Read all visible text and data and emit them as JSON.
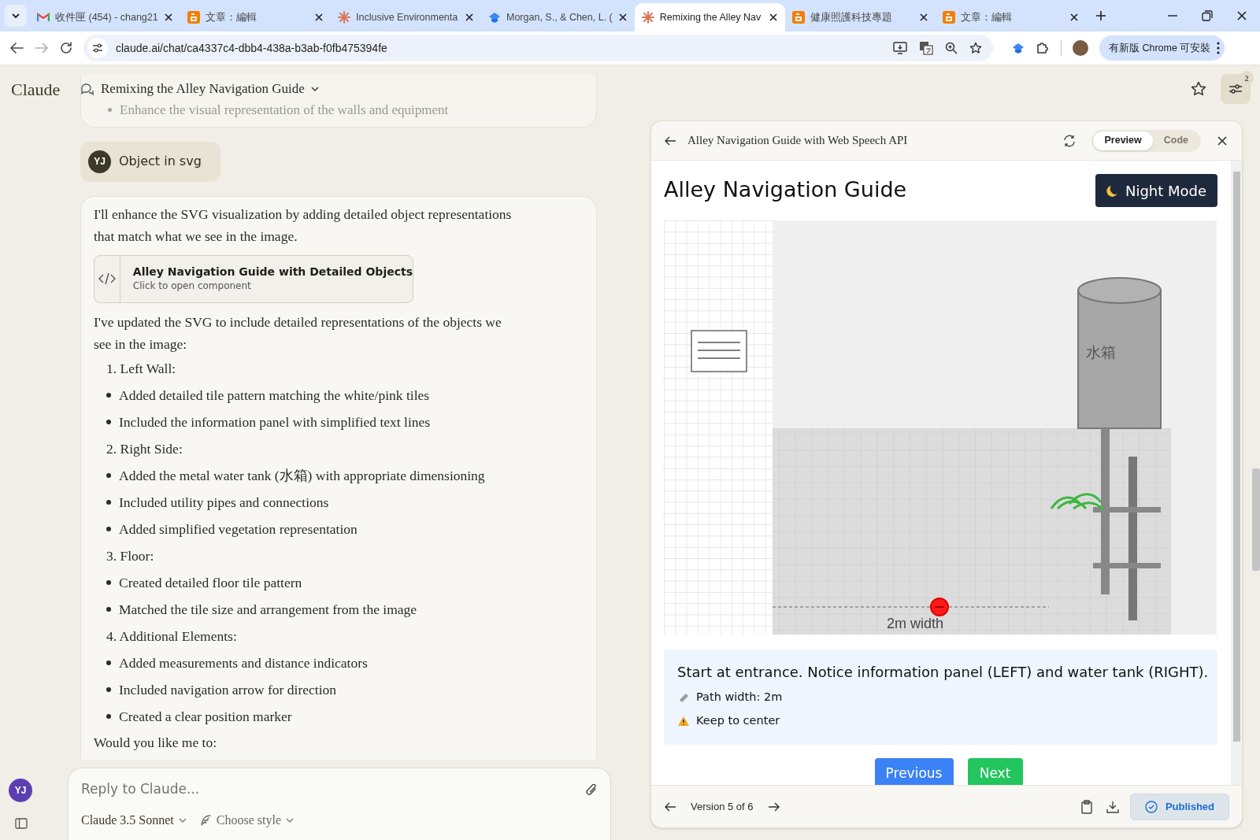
{
  "browser": {
    "tabs": [
      {
        "kind": "mail",
        "label": "收件匣 (454) - chang21",
        "selected": false
      },
      {
        "kind": "blog",
        "label": "文章：編輯",
        "selected": false
      },
      {
        "kind": "spark",
        "label": "Inclusive Environmenta",
        "selected": false
      },
      {
        "kind": "cap",
        "label": "Morgan, S., & Chen, L. (",
        "selected": false
      },
      {
        "kind": "spark",
        "label": "Remixing the Alley Nav",
        "selected": true
      },
      {
        "kind": "blog",
        "label": "健康照護科技專題",
        "selected": false
      },
      {
        "kind": "blog",
        "label": "文章：編輯",
        "selected": false
      }
    ],
    "url": "claude.ai/chat/ca4337c4-dbb4-438a-b3ab-f0fb475394fe",
    "update_button": "有新版 Chrome 可安裝"
  },
  "app": {
    "logo": "Claude",
    "chat_title": "Remixing the Alley Navigation Guide",
    "notification_count": "2"
  },
  "chat": {
    "previous_bullet": "Enhance the visual representation of the walls and equipment",
    "user_message": {
      "avatar": "YJ",
      "text": "Object in svg"
    },
    "reply": {
      "intro": "I'll enhance the SVG visualization by adding detailed object representations that match what we see in the image.",
      "artifact": {
        "title": "Alley Navigation Guide with Detailed Objects",
        "subtitle": "Click to open component"
      },
      "summary": "I've updated the SVG to include detailed representations of the objects we see in the image:",
      "items": [
        {
          "kind": "numbered",
          "number": "1.",
          "text": "Left Wall:"
        },
        {
          "kind": "bullet",
          "text": "Added detailed tile pattern matching the white/pink tiles"
        },
        {
          "kind": "bullet",
          "text": "Included the information panel with simplified text lines"
        },
        {
          "kind": "numbered",
          "number": "2.",
          "text": "Right Side:"
        },
        {
          "kind": "bullet",
          "text": "Added the metal water tank (水箱) with appropriate dimensioning"
        },
        {
          "kind": "bullet",
          "text": "Included utility pipes and connections"
        },
        {
          "kind": "bullet",
          "text": "Added simplified vegetation representation"
        },
        {
          "kind": "numbered",
          "number": "3.",
          "text": "Floor:"
        },
        {
          "kind": "bullet",
          "text": "Created detailed floor tile pattern"
        },
        {
          "kind": "bullet",
          "text": "Matched the tile size and arrangement from the image"
        },
        {
          "kind": "numbered",
          "number": "4.",
          "text": "Additional Elements:"
        },
        {
          "kind": "bullet",
          "text": "Added measurements and distance indicators"
        },
        {
          "kind": "bullet",
          "text": "Included navigation arrow for direction"
        },
        {
          "kind": "bullet",
          "text": "Created a clear position marker"
        }
      ],
      "closing": "Would you like me to:"
    }
  },
  "composer": {
    "placeholder": "Reply to Claude...",
    "model": "Claude 3.5 Sonnet",
    "style": "Choose style"
  },
  "user_avatar": "YJ",
  "artifact": {
    "title": "Alley Navigation Guide with Web Speech API",
    "tabs": [
      {
        "label": "Preview",
        "selected": true
      },
      {
        "label": "Code",
        "selected": false
      }
    ],
    "page": {
      "heading": "Alley Navigation Guide",
      "night_mode_button": "Night Mode",
      "scene": {
        "tank_label": "水箱",
        "width_label": "2m width"
      },
      "instruction": "Start at entrance. Notice information panel (LEFT) and water tank (RIGHT).",
      "notes": [
        {
          "kind": "ruler",
          "text": "Path width: 2m"
        },
        {
          "kind": "warning",
          "text": "Keep to center"
        }
      ],
      "buttons": [
        {
          "kind": "previous",
          "label": "Previous"
        },
        {
          "kind": "next",
          "label": "Next"
        }
      ]
    },
    "version": "Version 5 of 6",
    "published": "Published"
  }
}
